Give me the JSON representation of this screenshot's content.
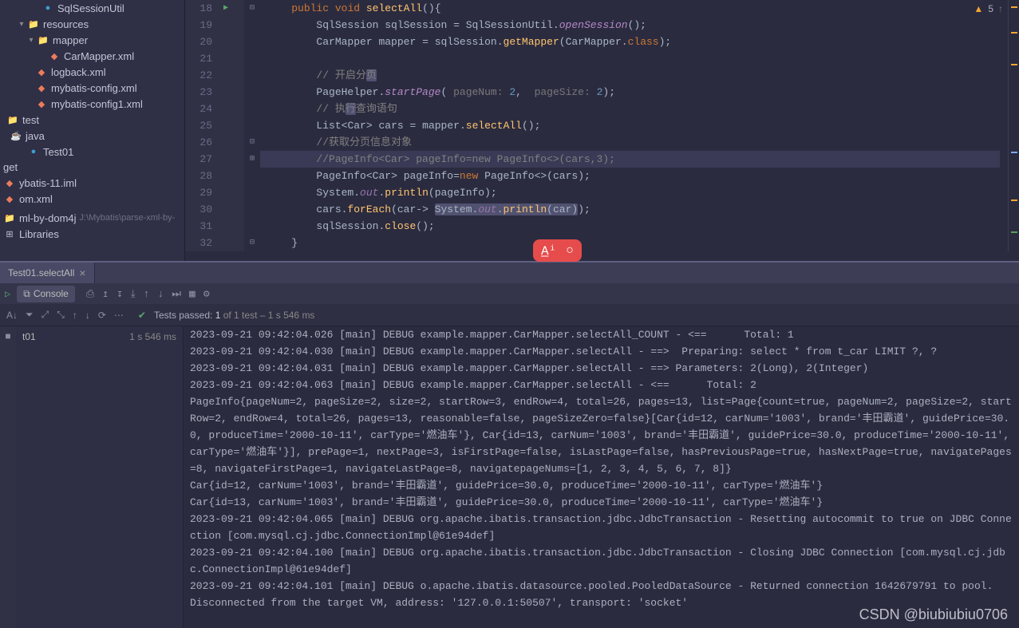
{
  "sidebar": {
    "items": [
      {
        "indent": 48,
        "chev": "",
        "icon": "class",
        "label": "SqlSessionUtil"
      },
      {
        "indent": 18,
        "chev": "▾",
        "icon": "folder",
        "label": "resources"
      },
      {
        "indent": 30,
        "chev": "▾",
        "icon": "folder",
        "label": "mapper"
      },
      {
        "indent": 56,
        "chev": "",
        "icon": "file",
        "label": "CarMapper.xml"
      },
      {
        "indent": 40,
        "chev": "",
        "icon": "file",
        "label": "logback.xml"
      },
      {
        "indent": 40,
        "chev": "",
        "icon": "file",
        "label": "mybatis-config.xml"
      },
      {
        "indent": 40,
        "chev": "",
        "icon": "file",
        "label": "mybatis-config1.xml"
      },
      {
        "indent": 4,
        "chev": "",
        "icon": "folder",
        "label": "test"
      },
      {
        "indent": 8,
        "chev": "",
        "icon": "java",
        "label": "java"
      },
      {
        "indent": 30,
        "chev": "",
        "icon": "class",
        "label": "Test01"
      },
      {
        "indent": 0,
        "chev": "",
        "icon": "",
        "label": "get"
      },
      {
        "indent": 0,
        "chev": "",
        "icon": "file",
        "label": "ybatis-11.iml"
      },
      {
        "indent": 0,
        "chev": "",
        "icon": "file",
        "label": "om.xml"
      },
      {
        "indent": 0,
        "chev": "",
        "icon": "",
        "label": ""
      },
      {
        "indent": 0,
        "chev": "",
        "icon": "folder",
        "label": "ml-by-dom4j",
        "hint": "J:\\Mybatis\\parse-xml-by-"
      },
      {
        "indent": 0,
        "chev": "",
        "icon": "lib",
        "label": "Libraries"
      }
    ]
  },
  "editor": {
    "warn_count": "5",
    "lines": [
      {
        "n": "18",
        "run": true,
        "fold": "-",
        "html": "    <span class='kw'>public</span> <span class='kw'>void</span> <span class='fn-decl'>selectAll</span><span class='paren'>(){</span>"
      },
      {
        "n": "19",
        "html": "        <span class='type'>SqlSession</span> <span class='type'>sqlSession</span> <span class='paren'>=</span> <span class='type'>SqlSessionUtil</span>.<span class='method-i'>openSession</span><span class='paren'>();</span>"
      },
      {
        "n": "20",
        "html": "        <span class='type'>CarMapper</span> <span class='type'>mapper</span> <span class='paren'>=</span> <span class='type'>sqlSession</span>.<span class='method'>getMapper</span><span class='paren'>(</span><span class='type'>CarMapper</span>.<span class='kw'>class</span><span class='paren'>);</span>"
      },
      {
        "n": "21",
        "html": ""
      },
      {
        "n": "22",
        "html": "        <span class='comment'>// 开启分<span class='caret-bg'>页</span></span>"
      },
      {
        "n": "23",
        "html": "        <span class='type'>PageHelper</span>.<span class='method-i'>startPage</span><span class='paren'>(</span> <span class='hint'>pageNum:</span> <span class='num'>2</span><span class='paren'>,</span>  <span class='hint'>pageSize:</span> <span class='num'>2</span><span class='paren'>);</span>"
      },
      {
        "n": "24",
        "html": "        <span class='comment'>// 执<span class='caret-bg'>行</span>查询语句</span>"
      },
      {
        "n": "25",
        "html": "        <span class='type'>List</span><span class='paren'>&lt;</span><span class='type'>Car</span><span class='paren'>&gt;</span> <span class='type'>cars</span> <span class='paren'>=</span> <span class='type'>mapper</span>.<span class='method'>selectAll</span><span class='paren'>();</span>"
      },
      {
        "n": "26",
        "fold": "-",
        "html": "        <span class='comment'>//获取分页信息对象</span>"
      },
      {
        "n": "27",
        "hl": true,
        "fold": "+",
        "html": "        <span class='comment'>//PageInfo&lt;Car&gt; pageInfo=new PageInfo&lt;&gt;(cars,3);</span>"
      },
      {
        "n": "28",
        "html": "        <span class='type'>PageInfo</span><span class='paren'>&lt;</span><span class='type'>Car</span><span class='paren'>&gt;</span> <span class='type'>pageInfo</span><span class='paren'>=</span><span class='kw'>new</span> <span class='type'>PageInfo</span><span class='paren'>&lt;&gt;(</span><span class='type'>cars</span><span class='paren'>);</span>"
      },
      {
        "n": "29",
        "html": "        <span class='type'>System</span>.<span class='field'>out</span>.<span class='method'>println</span><span class='paren'>(</span><span class='type'>pageInfo</span><span class='paren'>);</span>"
      },
      {
        "n": "30",
        "html": "        <span class='type'>cars</span>.<span class='method'>forEach</span><span class='paren'>(</span><span class='type'>car</span><span class='paren'>-&gt;</span> <span class='caret-bg'><span class='type'>System</span>.<span class='field'>out</span>.<span class='method'>println</span><span class='paren'>(</span><span class='type'>car</span><span class='paren'>)</span></span><span class='paren'>);</span>"
      },
      {
        "n": "31",
        "html": "        <span class='type'>sqlSession</span>.<span class='method'>close</span><span class='paren'>();</span>"
      },
      {
        "n": "32",
        "fold": "-",
        "html": "    <span class='paren'>}</span>"
      }
    ]
  },
  "run": {
    "tab_label": "Test01.selectAll",
    "subtab_label": "Console",
    "toolbar": {
      "tests": "Tests passed: ",
      "n1": "1",
      "mid": " of 1 test ",
      "time": "– 1 s 546 ms"
    },
    "tree": {
      "label": "t01",
      "time": "1 s 546 ms"
    },
    "console_lines": [
      "2023-09-21 09:42:04.026 [main] DEBUG example.mapper.CarMapper.selectAll_COUNT - <==      Total: 1",
      "2023-09-21 09:42:04.030 [main] DEBUG example.mapper.CarMapper.selectAll - ==>  Preparing: select * from t_car LIMIT ?, ?",
      "2023-09-21 09:42:04.031 [main] DEBUG example.mapper.CarMapper.selectAll - ==> Parameters: 2(Long), 2(Integer)",
      "2023-09-21 09:42:04.063 [main] DEBUG example.mapper.CarMapper.selectAll - <==      Total: 2",
      "PageInfo{pageNum=2, pageSize=2, size=2, startRow=3, endRow=4, total=26, pages=13, list=Page{count=true, pageNum=2, pageSize=2, startRow=2, endRow=4, total=26, pages=13, reasonable=false, pageSizeZero=false}[Car{id=12, carNum='1003', brand='丰田霸道', guidePrice=30.0, produceTime='2000-10-11', carType='燃油车'}, Car{id=13, carNum='1003', brand='丰田霸道', guidePrice=30.0, produceTime='2000-10-11', carType='燃油车'}], prePage=1, nextPage=3, isFirstPage=false, isLastPage=false, hasPreviousPage=true, hasNextPage=true, navigatePages=8, navigateFirstPage=1, navigateLastPage=8, navigatepageNums=[1, 2, 3, 4, 5, 6, 7, 8]}",
      "Car{id=12, carNum='1003', brand='丰田霸道', guidePrice=30.0, produceTime='2000-10-11', carType='燃油车'}",
      "Car{id=13, carNum='1003', brand='丰田霸道', guidePrice=30.0, produceTime='2000-10-11', carType='燃油车'}",
      "2023-09-21 09:42:04.065 [main] DEBUG org.apache.ibatis.transaction.jdbc.JdbcTransaction - Resetting autocommit to true on JDBC Connection [com.mysql.cj.jdbc.ConnectionImpl@61e94def]",
      "2023-09-21 09:42:04.100 [main] DEBUG org.apache.ibatis.transaction.jdbc.JdbcTransaction - Closing JDBC Connection [com.mysql.cj.jdbc.ConnectionImpl@61e94def]",
      "2023-09-21 09:42:04.101 [main] DEBUG o.apache.ibatis.datasource.pooled.PooledDataSource - Returned connection 1642679791 to pool.",
      "Disconnected from the target VM, address: '127.0.0.1:50507', transport: 'socket'"
    ]
  },
  "watermark": "CSDN @biubiubiu0706"
}
